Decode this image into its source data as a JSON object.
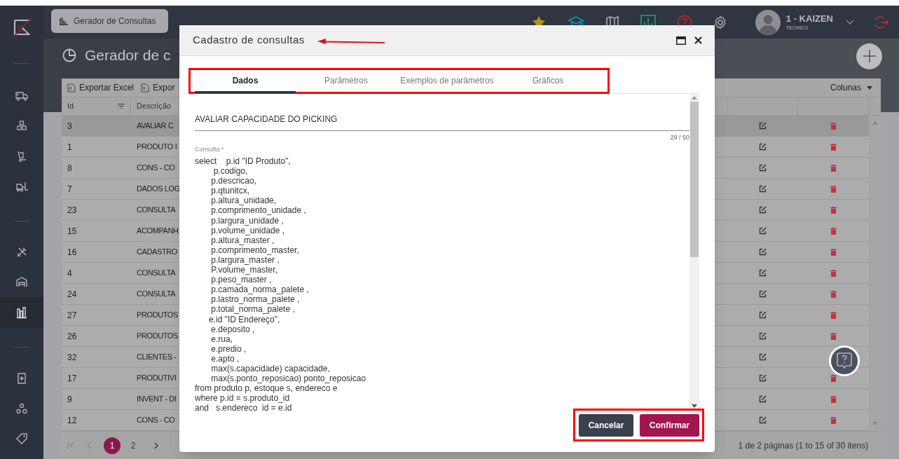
{
  "app_tab": {
    "label": "Gerador de Consultas"
  },
  "user": {
    "name": "1 - KAIZEN",
    "role": "TECNICO"
  },
  "sidebar": {
    "groups": [
      {
        "items": [
          {
            "selected": false
          },
          {
            "selected": false
          },
          {
            "selected": false
          },
          {
            "selected": false
          }
        ]
      },
      {
        "items": [
          {
            "selected": false
          },
          {
            "selected": false
          },
          {
            "selected": true
          }
        ]
      },
      {
        "items": [
          {
            "selected": false
          },
          {
            "selected": false
          },
          {
            "selected": false
          }
        ]
      }
    ]
  },
  "page": {
    "title": "Gerador de c",
    "toolbar": [
      "Exportar Excel",
      "Expor"
    ],
    "columns_button": "Colunas",
    "table": {
      "columns": [
        "Id",
        "Descrição"
      ],
      "rows": [
        {
          "id": "3",
          "description": "AVALIAR C",
          "selected": true
        },
        {
          "id": "1",
          "description": "PRODUTO I",
          "selected": false
        },
        {
          "id": "8",
          "description": "CONS - CO",
          "selected": false
        },
        {
          "id": "7",
          "description": "DADOS LOG",
          "selected": false
        },
        {
          "id": "23",
          "description": "CONSULTA",
          "selected": false
        },
        {
          "id": "15",
          "description": "ACOMPANH",
          "selected": false
        },
        {
          "id": "16",
          "description": "CADASTRO",
          "selected": false
        },
        {
          "id": "4",
          "description": "CONSULTA",
          "selected": false
        },
        {
          "id": "24",
          "description": "CONSULTA",
          "selected": false
        },
        {
          "id": "27",
          "description": "PRODUTOS",
          "selected": false
        },
        {
          "id": "26",
          "description": "PRODUTOS",
          "selected": false
        },
        {
          "id": "32",
          "description": "CLIENTES -",
          "selected": false
        },
        {
          "id": "17",
          "description": "PRODUTIVI",
          "selected": false
        },
        {
          "id": "9",
          "description": "INVENT - DI",
          "selected": false
        },
        {
          "id": "12",
          "description": "CONS - CO",
          "selected": false
        }
      ]
    },
    "pagination": {
      "pages": [
        {
          "label": "1",
          "selected": true
        },
        {
          "label": "2",
          "selected": false
        }
      ],
      "summary": "1 de 2 páginas (1 to 15 of 30 itens)"
    }
  },
  "modal": {
    "title": "Cadastro de consultas",
    "tabs": [
      {
        "label": "Dados",
        "selected": true
      },
      {
        "label": "Parâmetros",
        "selected": false
      },
      {
        "label": "Exemplos de parâmetros",
        "selected": false
      },
      {
        "label": "Gráficos",
        "selected": false
      }
    ],
    "name_field": {
      "value": "AVALIAR CAPACIDADE DO PICKING",
      "counter": "29 / 50"
    },
    "query_field": {
      "label": "Consulta *",
      "value": "select    p.id \"ID Produto\",\n        p.codigo,\n       p.descricao,\n       p.qtunitcx,\n       p.altura_unidade,\n       p.comprimento_unidade ,\n       p.largura_unidade ,\n       p.volume_unidade ,\n       p.altura_master ,\n       p.comprimento_master,\n       p.largura_master ,\n       P.volume_master,\n       p.peso_master ,\n       p.camada_norma_palete ,\n       p.lastro_norma_palete ,\n       p.total_norma_palete ,\n      e.id \"ID Endereço\",\n       e.deposito ,\n       e.rua,\n       e.predio ,\n       e.apto ,\n       max(s.capacidade) capacidade,\n       max(s.ponto_reposicao) ponto_reposicao\nfrom produto p, estoque s, endereco e\nwhere p.id = s.produto_id\nand   s.endereco  id = e.id"
    },
    "buttons": [
      {
        "label": "Cancelar",
        "kind": "secondary"
      },
      {
        "label": "Confirmar",
        "kind": "primary"
      }
    ]
  }
}
